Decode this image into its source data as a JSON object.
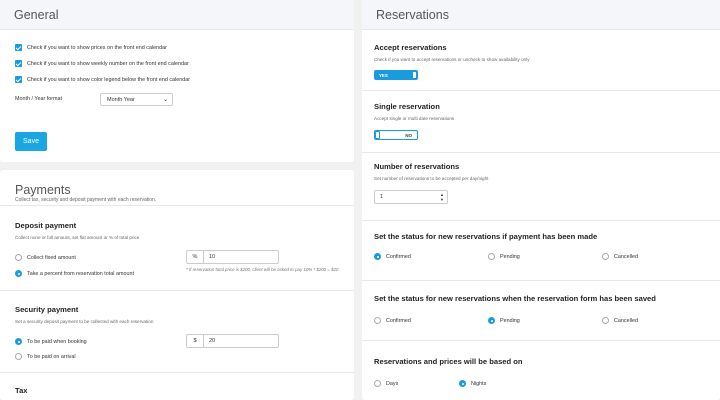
{
  "general": {
    "title": "General",
    "checkboxes": [
      {
        "label": "Check if you want to show prices on the front end calendar",
        "checked": true
      },
      {
        "label": "Check if you want to show weekly number on the front end calendar",
        "checked": true
      },
      {
        "label": "Check if you want to show color legend below the front end calendar",
        "checked": true
      }
    ],
    "format_label": "Month / Year format",
    "format_value": "Month Year",
    "save_label": "Save"
  },
  "payments": {
    "title": "Payments",
    "description": "Collect tax, security and deposit payment with each reservation.",
    "deposit": {
      "title": "Deposit payment",
      "description": "Collect none or full amount, set flat amount or % of total price",
      "options": [
        {
          "label": "Collect fixed amount",
          "selected": false
        },
        {
          "label": "Take a percent from reservation total amount",
          "selected": true
        }
      ],
      "addon": "%",
      "value": "10",
      "note": "* If reservation total price is $200, client will be asked to pay 10% * $200 = $20"
    },
    "security": {
      "title": "Security payment",
      "description": "Set a security deposit payment to be collected with each reservation",
      "options": [
        {
          "label": "To be paid when booking",
          "selected": true
        },
        {
          "label": "To be paid on arrival",
          "selected": false
        }
      ],
      "addon": "$",
      "value": "20"
    },
    "tax_title": "Tax"
  },
  "reservations": {
    "title": "Reservations",
    "accept": {
      "title": "Accept reservations",
      "description": "Check if you want to accept reservations or uncheck to show availability only",
      "toggle_text": "YES",
      "on": true
    },
    "single": {
      "title": "Single reservation",
      "description": "Accept single or multi date reservations",
      "toggle_text": "NO",
      "on": false
    },
    "number": {
      "title": "Number of reservations",
      "description": "Set number of reservations to be accepted per day/night",
      "value": "1"
    },
    "status_paid": {
      "title": "Set the status for new reservations if payment has been made",
      "options": [
        {
          "label": "Confirmed",
          "selected": true
        },
        {
          "label": "Pending",
          "selected": false
        },
        {
          "label": "Cancelled",
          "selected": false
        }
      ]
    },
    "status_saved": {
      "title": "Set the status for new reservations when the reservation form has been saved",
      "options": [
        {
          "label": "Confirmed",
          "selected": false
        },
        {
          "label": "Pending",
          "selected": true
        },
        {
          "label": "Cancelled",
          "selected": false
        }
      ]
    },
    "based_on": {
      "title": "Reservations and prices will be based on",
      "options": [
        {
          "label": "Days",
          "selected": false
        },
        {
          "label": "Nights",
          "selected": true
        }
      ]
    }
  }
}
